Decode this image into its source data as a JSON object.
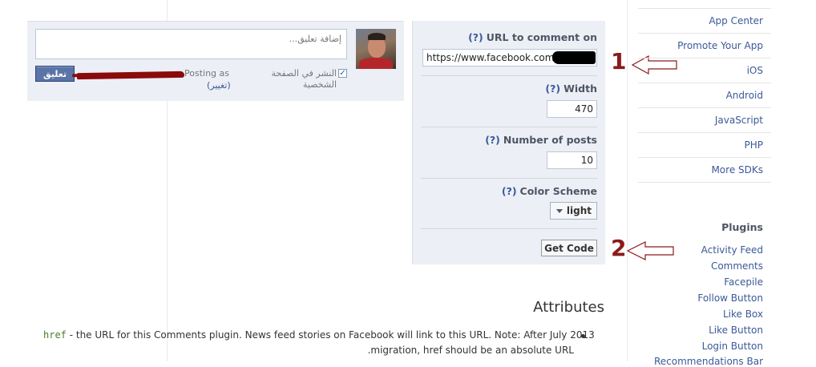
{
  "comment_preview": {
    "comment_placeholder": "إضافة تعليق...",
    "post_button_label": "تعليق",
    "posting_as_label": "Posting as",
    "change_link_label": "(تغيير)",
    "share_to_timeline_label": "النشر في الصفحة الشخصية",
    "share_to_timeline_checked": true
  },
  "configurator": {
    "help_marker": "(?)",
    "url_label": "URL to comment on",
    "url_value": "https://www.facebook.com/",
    "width_label": "Width",
    "width_value": "470",
    "num_posts_label": "Number of posts",
    "num_posts_value": "10",
    "color_scheme_label": "Color Scheme",
    "color_scheme_value": "light",
    "get_code_label": "Get Code"
  },
  "annotations": {
    "marker_1": "1",
    "marker_2": "2",
    "color": "#8b1a1a"
  },
  "sidebar": {
    "sdk_items": [
      "App Center",
      "Promote Your App",
      "iOS",
      "Android",
      "JavaScript",
      "PHP",
      "More SDKs"
    ],
    "plugins_heading": "Plugins",
    "plugin_items": [
      "Activity Feed",
      "Comments",
      "Facepile",
      "Follow Button",
      "Like Box",
      "Like Button",
      "Login Button",
      "Recommendations Bar"
    ]
  },
  "attributes": {
    "heading": "Attributes",
    "href_code": "href",
    "href_text_line1": " - the URL for this Comments plugin. News feed stories on Facebook will link to this URL. Note: After July 2013",
    "href_text_line2": ".migration, href should be an absolute URL"
  },
  "colors": {
    "link": "#3b5998",
    "panel_bg": "#eceff5",
    "button_blue": "#5b74a8",
    "redaction_red": "#8b0a0a"
  }
}
